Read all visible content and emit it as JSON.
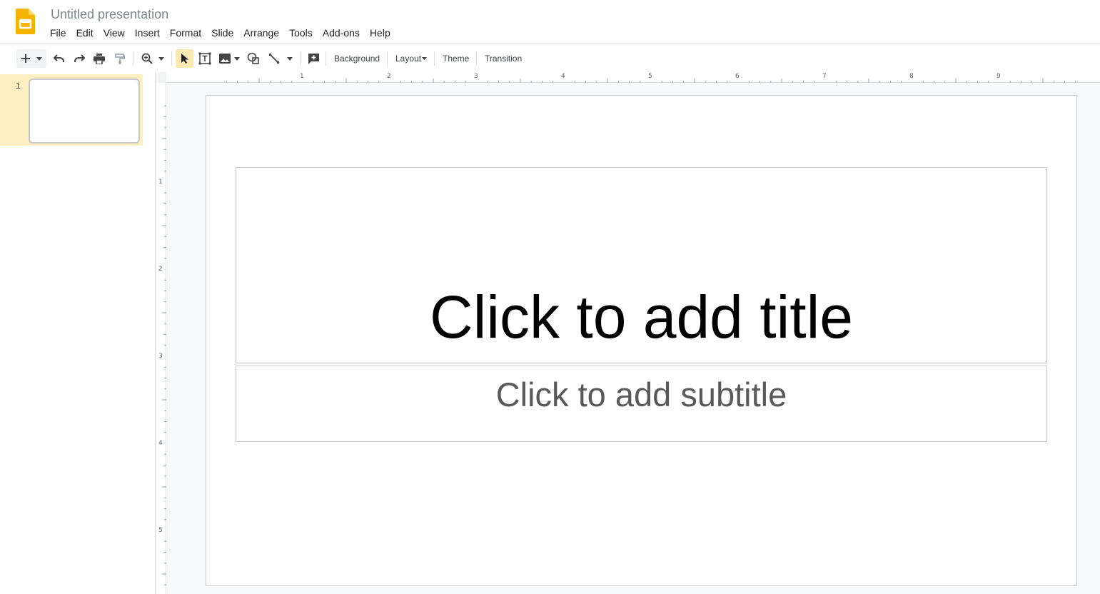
{
  "document": {
    "title": "Untitled presentation"
  },
  "menu": [
    {
      "label": "File"
    },
    {
      "label": "Edit"
    },
    {
      "label": "View"
    },
    {
      "label": "Insert"
    },
    {
      "label": "Format"
    },
    {
      "label": "Slide"
    },
    {
      "label": "Arrange"
    },
    {
      "label": "Tools"
    },
    {
      "label": "Add-ons"
    },
    {
      "label": "Help"
    }
  ],
  "toolbar": {
    "background_label": "Background",
    "layout_label": "Layout",
    "theme_label": "Theme",
    "transition_label": "Transition",
    "icons": [
      "new-slide-icon",
      "undo-icon",
      "redo-icon",
      "print-icon",
      "paint-format-icon",
      "zoom-icon",
      "select-icon",
      "text-box-icon",
      "image-icon",
      "shape-icon",
      "line-icon",
      "comment-icon"
    ]
  },
  "filmstrip": {
    "slides": [
      {
        "number": "1"
      }
    ]
  },
  "rulers": {
    "horizontal": [
      "1",
      "2",
      "3",
      "4",
      "5",
      "6",
      "7",
      "8",
      "9"
    ],
    "vertical": [
      "1",
      "2",
      "3",
      "4",
      "5"
    ]
  },
  "slide": {
    "title_placeholder": "Click to add title",
    "subtitle_placeholder": "Click to add subtitle"
  },
  "colors": {
    "accent": "#fbbc04",
    "selection": "#feefc3",
    "border": "#dadce0",
    "canvas": "#f8f9fa"
  }
}
